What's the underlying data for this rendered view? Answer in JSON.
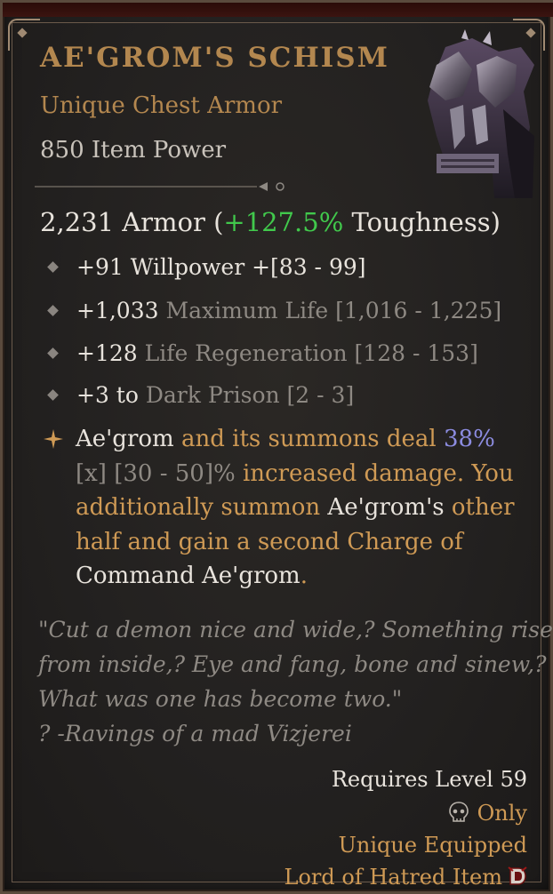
{
  "item": {
    "name": "AE'GROM'S SCHISM",
    "type": "Unique Chest Armor",
    "item_power": "850 Item Power"
  },
  "armor": {
    "value": "2,231 Armor (",
    "toughness": "+127.5%",
    "toughness_label": " Toughness)"
  },
  "affixes": [
    {
      "value": "+91 Willpower +[83 - 99]",
      "range": ""
    },
    {
      "value": "+1,033 ",
      "name": "Maximum Life",
      "range": " [1,016 - 1,225]"
    },
    {
      "value": "+128 ",
      "name": "Life Regeneration",
      "range": " [128 - 153]"
    },
    {
      "value": "+3 to ",
      "name": "Dark Prison",
      "range": " [2 - 3]"
    }
  ],
  "unique_effect": {
    "l1_a": "Ae'grom",
    "l1_b": " and its summons deal ",
    "l1_c": "38%",
    "l2_a": "[x] [30 - 50]%",
    "l2_b": " increased damage. You",
    "l3_a": "additionally summon ",
    "l3_b": "Ae'grom's",
    "l3_c": " other",
    "l4": "half and gain a second Charge of",
    "l5_a": "Command Ae'grom",
    "l5_b": "."
  },
  "flavor": [
    "\"Cut a demon nice and wide,? Something rises",
    "from inside,? Eye and fang, bone and sinew,?",
    "What was one has become two.\"",
    "? -Ravings of a mad Vizjerei"
  ],
  "requirements": {
    "level": "Requires Level 59",
    "class_only": "Only",
    "unique_equipped": "Unique Equipped",
    "expansion": "Lord of Hatred Item"
  },
  "colors": {
    "title": "#b3874f",
    "unique": "#cf9a55",
    "toughness": "#41c94c",
    "highlight": "#8c8ce0"
  },
  "icons": [
    "chest-armor-icon",
    "divider-ornament-icon",
    "affix-bullet-icon",
    "unique-star-icon",
    "class-skull-icon",
    "expansion-d-icon"
  ]
}
